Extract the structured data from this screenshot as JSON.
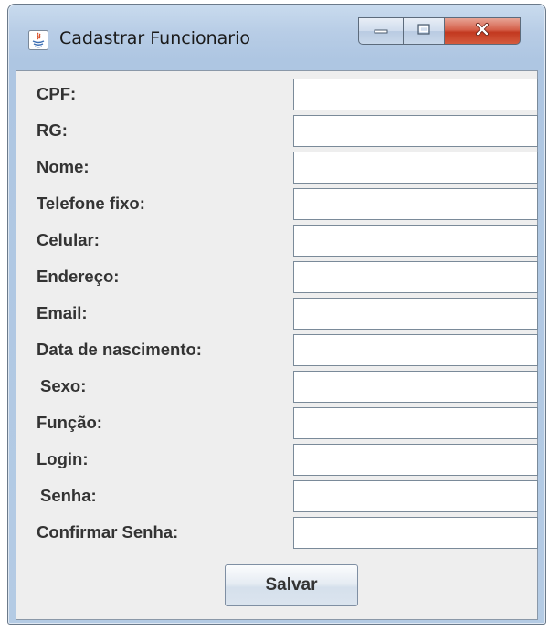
{
  "window": {
    "title": "Cadastrar Funcionario",
    "app_icon": "java-icon",
    "controls": [
      {
        "name": "minimize",
        "icon": "minimize-icon"
      },
      {
        "name": "maximize",
        "icon": "maximize-icon"
      },
      {
        "name": "close",
        "icon": "close-icon"
      }
    ]
  },
  "form": {
    "fields": [
      {
        "label": "CPF:",
        "value": ""
      },
      {
        "label": "RG:",
        "value": ""
      },
      {
        "label": "Nome:",
        "value": ""
      },
      {
        "label": "Telefone fixo:",
        "value": ""
      },
      {
        "label": "Celular:",
        "value": ""
      },
      {
        "label": "Endereço:",
        "value": ""
      },
      {
        "label": "Email:",
        "value": ""
      },
      {
        "label": "Data de nascimento:",
        "value": ""
      },
      {
        "label": "Sexo:",
        "value": ""
      },
      {
        "label": "Função:",
        "value": ""
      },
      {
        "label": "Login:",
        "value": ""
      },
      {
        "label": "Senha:",
        "value": ""
      },
      {
        "label": "Confirmar Senha:",
        "value": ""
      }
    ],
    "save_label": "Salvar"
  },
  "colors": {
    "frame": "#b8cde6",
    "client_background": "#eeeeee",
    "close_button": "#c2381f",
    "label_text": "#333333"
  }
}
